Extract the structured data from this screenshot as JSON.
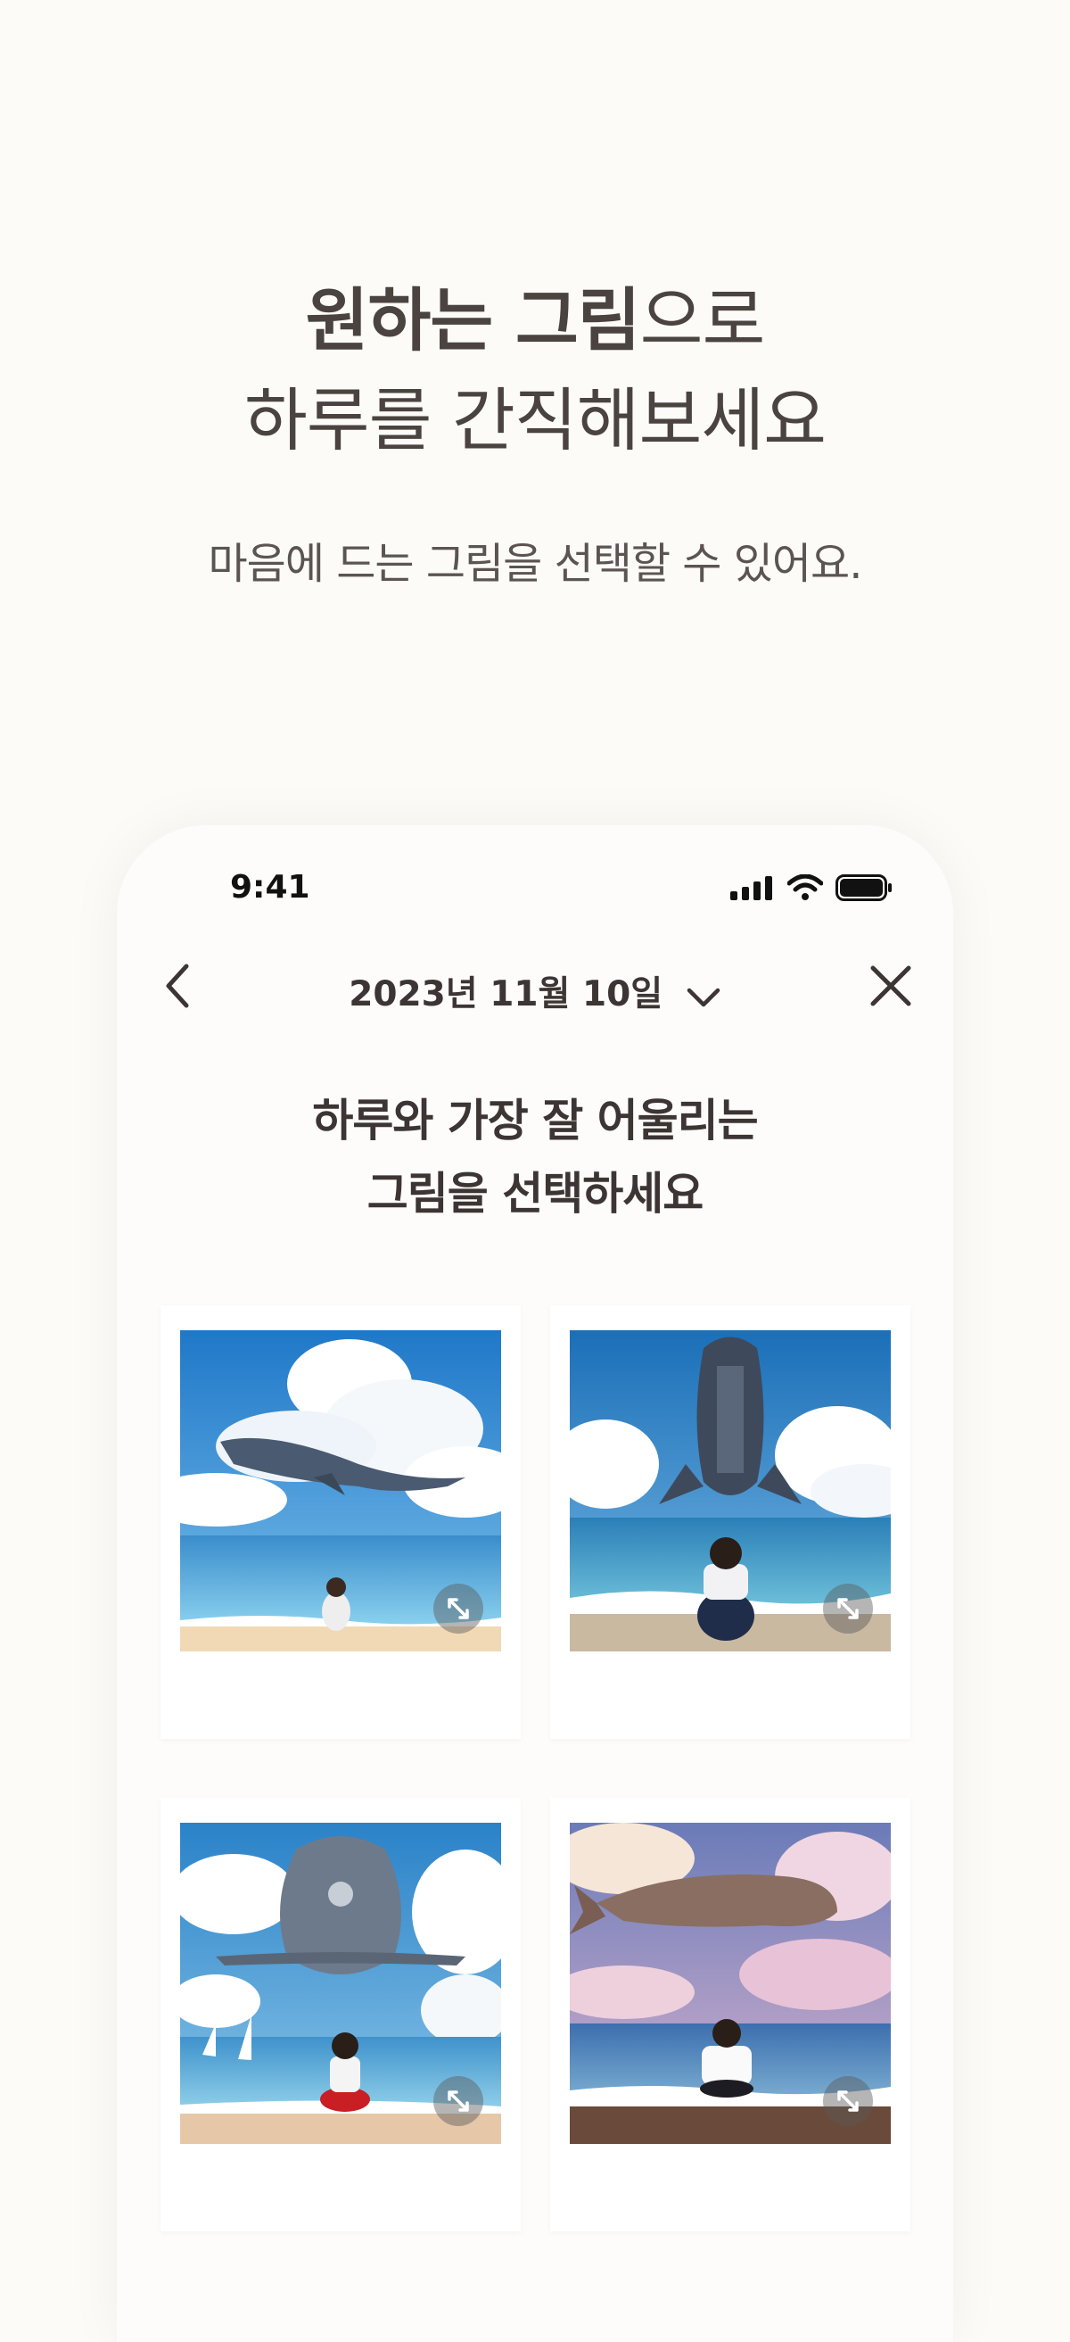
{
  "hero": {
    "title_line1_bold": "원하는 그림",
    "title_line1_rest": "으로",
    "title_line2": "하루를 간직해보세요",
    "subtitle": "마음에 드는 그림을 선택할 수 있어요."
  },
  "status_bar": {
    "time": "9:41"
  },
  "nav": {
    "date": "2023년 11월 10일"
  },
  "prompt": {
    "line1": "하루와 가장 잘 어울리는",
    "line2": "그림을 선택하세요"
  },
  "images": [
    {
      "subject": "whale-over-sea-girl-beach"
    },
    {
      "subject": "whale-vertical-girl-shore"
    },
    {
      "subject": "mechanical-whale-girl-sea"
    },
    {
      "subject": "whale-pink-sky-girl"
    }
  ],
  "icons": [
    "back-arrow-icon",
    "chevron-down-icon",
    "close-icon",
    "signal-icon",
    "wifi-icon",
    "battery-icon",
    "expand-icon"
  ]
}
